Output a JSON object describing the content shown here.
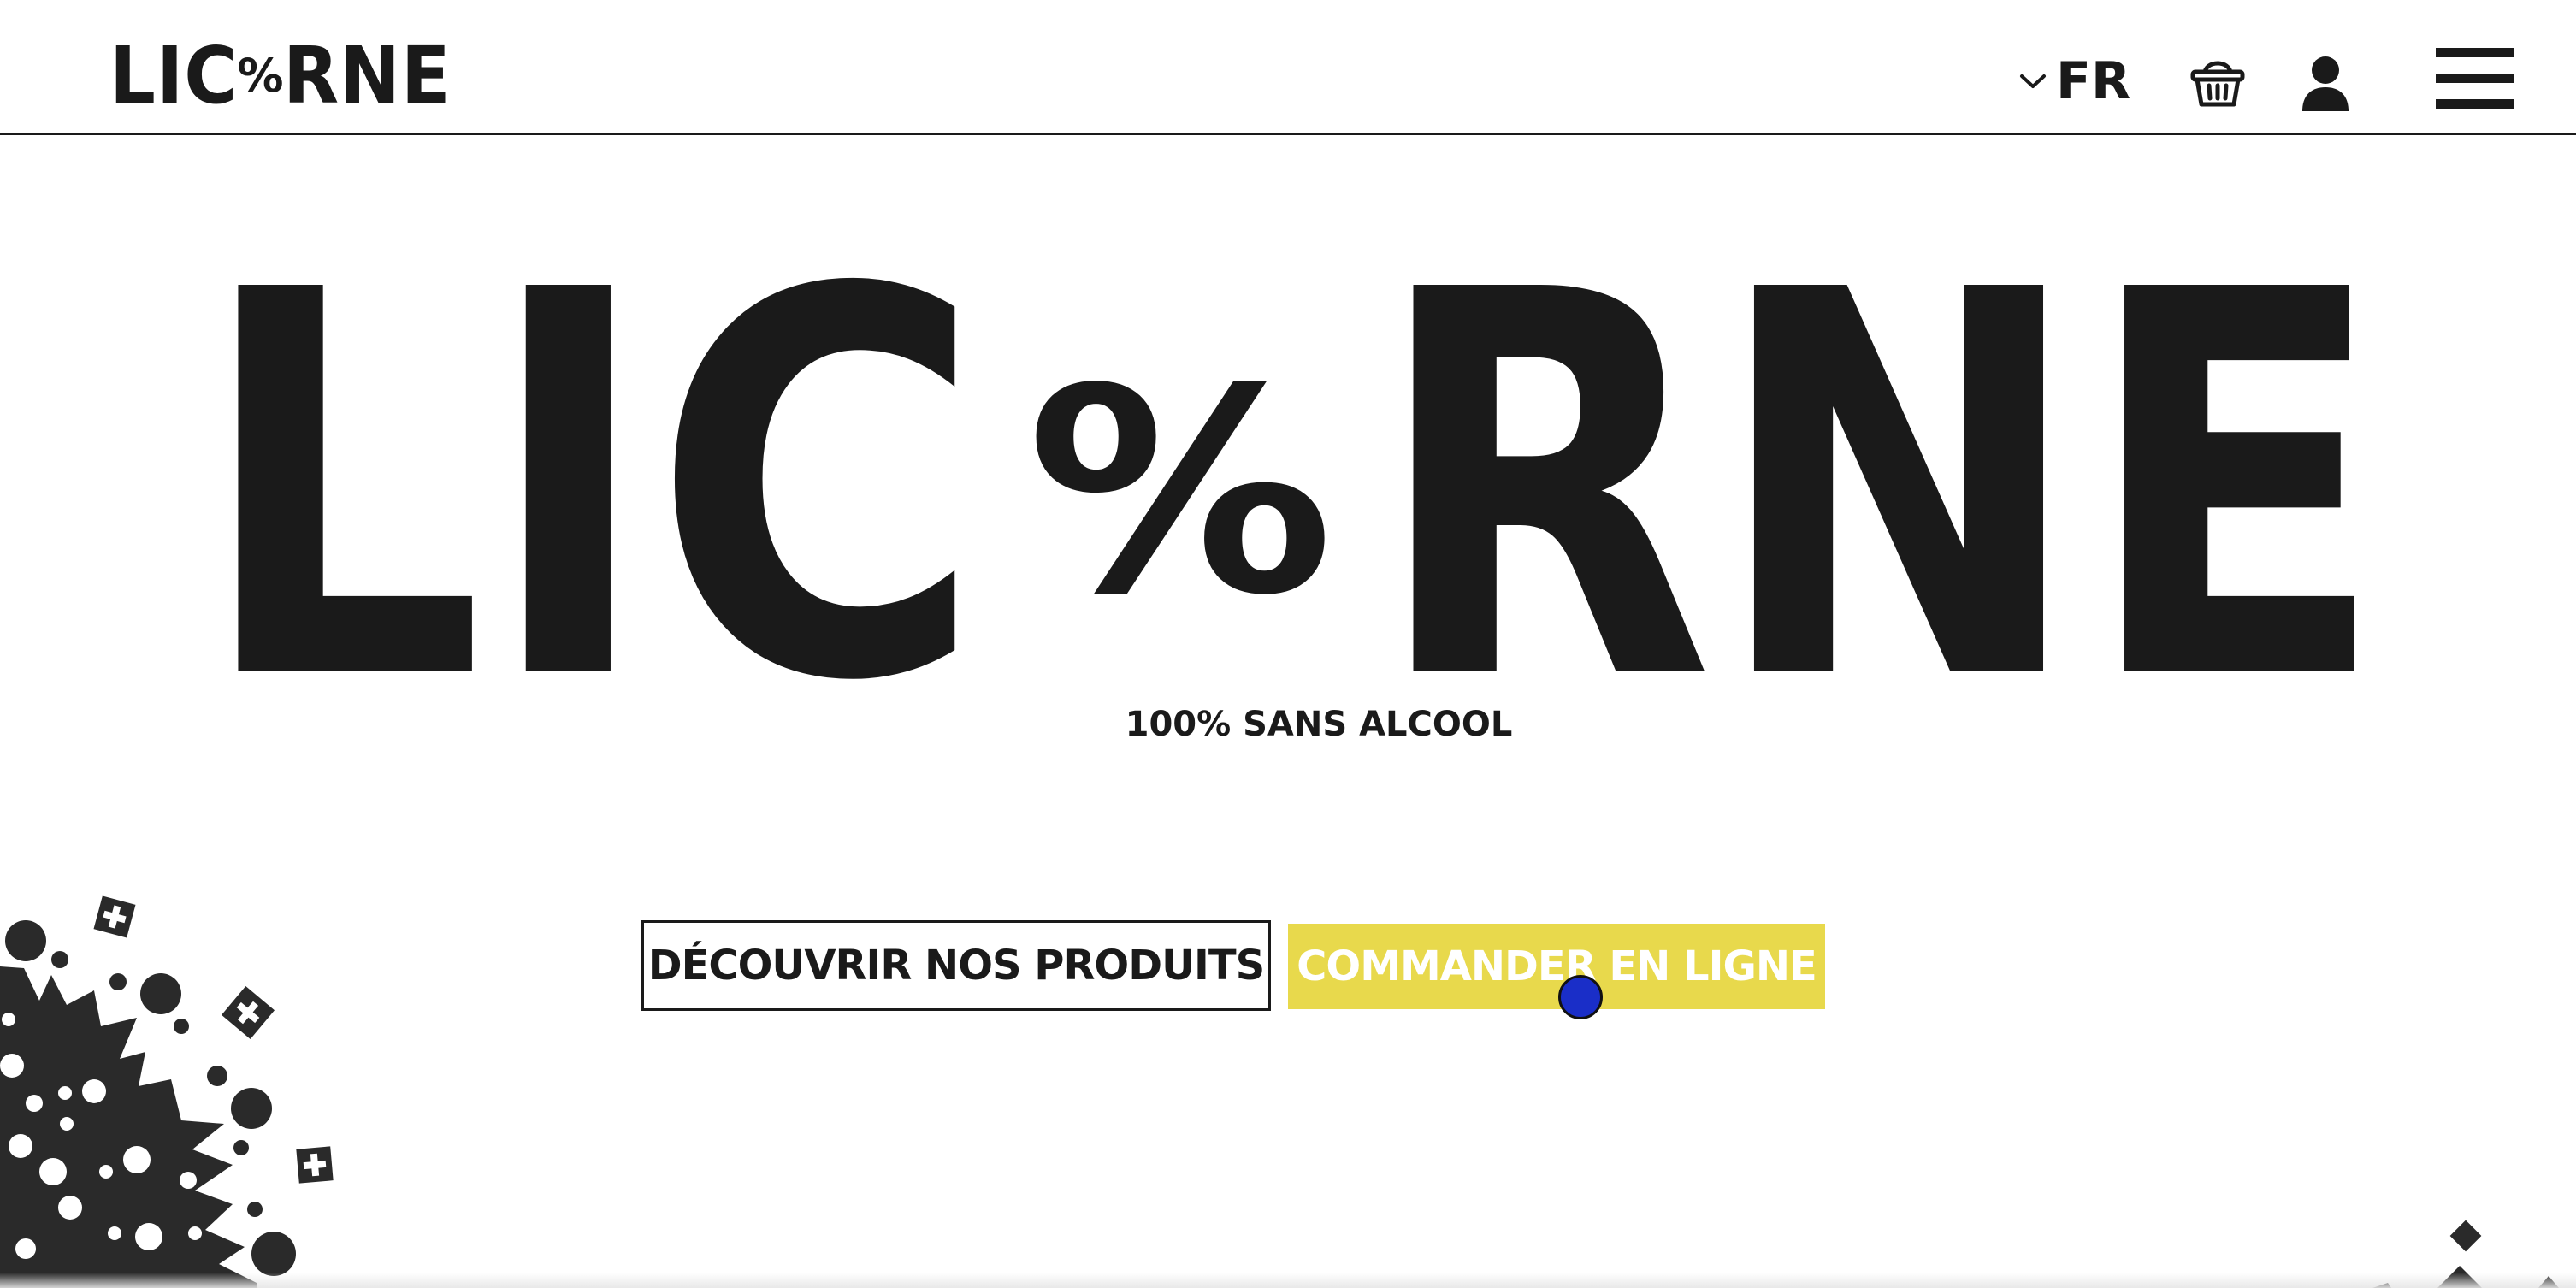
{
  "header": {
    "logo": {
      "left_text": "LIC",
      "percent_symbol": "%",
      "right_text": "RNE"
    },
    "language": {
      "selected": "FR",
      "chevron_icon": "chevron-down-icon"
    },
    "icons": {
      "basket": "basket-icon",
      "user": "user-icon",
      "menu": "hamburger-menu-icon"
    }
  },
  "hero": {
    "wordmark": {
      "left_text": "LIC",
      "percent_symbol": "%",
      "right_text": "RNE"
    },
    "tagline": "100% SANS ALCOOL",
    "buttons": {
      "discover_label": "DÉCOUVRIR NOS PRODUITS",
      "order_label": "COMMANDER EN LIGNE"
    }
  },
  "colors": {
    "text": "#1a1a1a",
    "background": "#ffffff",
    "accent_yellow": "#e8d94c",
    "cursor_blue": "#1a2ec8"
  }
}
